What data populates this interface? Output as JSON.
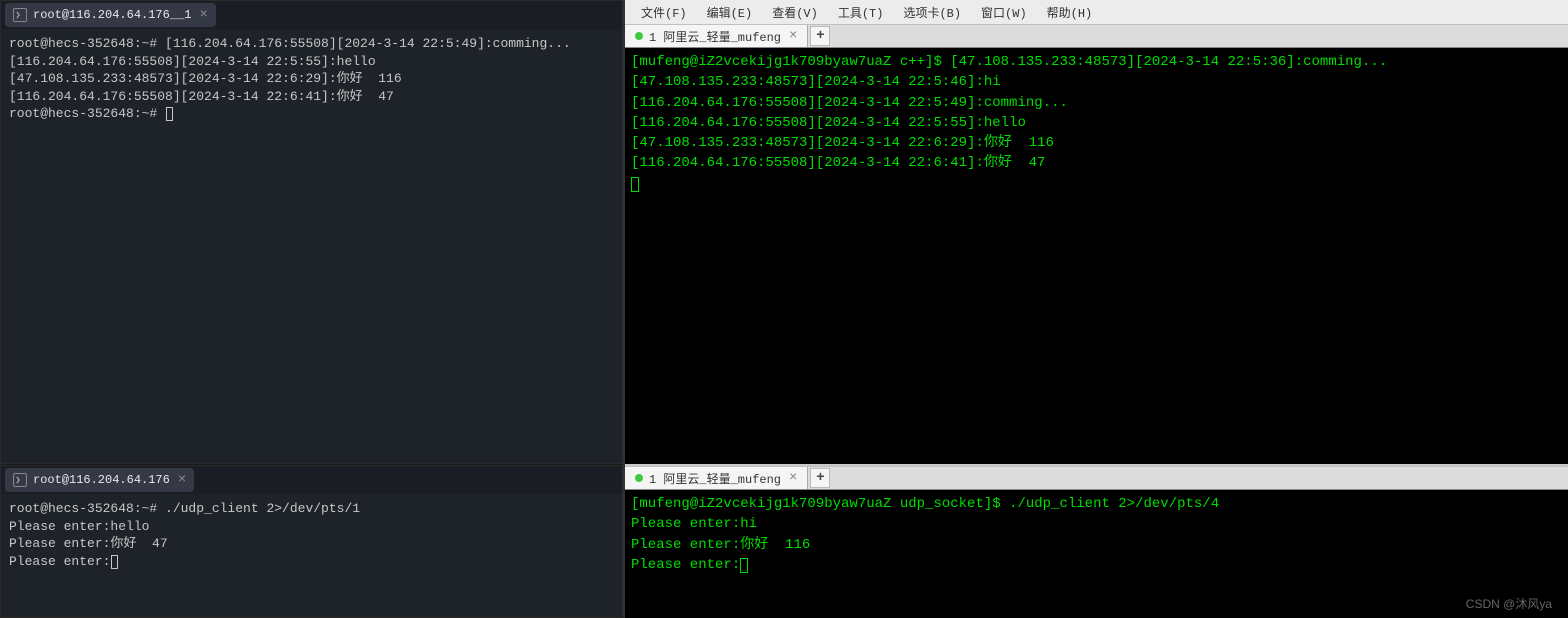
{
  "left_top": {
    "tab_title": "root@116.204.64.176__1",
    "lines": [
      "root@hecs-352648:~# [116.204.64.176:55508][2024-3-14 22:5:49]:comming...",
      "[116.204.64.176:55508][2024-3-14 22:5:55]:hello",
      "[47.108.135.233:48573][2024-3-14 22:6:29]:你好  116",
      "[116.204.64.176:55508][2024-3-14 22:6:41]:你好  47",
      "root@hecs-352648:~# "
    ]
  },
  "left_bottom": {
    "tab_title": "root@116.204.64.176",
    "lines": [
      "root@hecs-352648:~# ./udp_client 2>/dev/pts/1",
      "Please enter:hello",
      "Please enter:你好  47",
      "Please enter:"
    ]
  },
  "right_menu": [
    "文件(F)",
    "编辑(E)",
    "查看(V)",
    "工具(T)",
    "选项卡(B)",
    "窗口(W)",
    "帮助(H)"
  ],
  "right_top": {
    "tab_title": "1 阿里云_轻量_mufeng",
    "lines": [
      "[mufeng@iZ2vcekijg1k709byaw7uaZ c++]$ [47.108.135.233:48573][2024-3-14 22:5:36]:comming...",
      "[47.108.135.233:48573][2024-3-14 22:5:46]:hi",
      "[116.204.64.176:55508][2024-3-14 22:5:49]:comming...",
      "[116.204.64.176:55508][2024-3-14 22:5:55]:hello",
      "[47.108.135.233:48573][2024-3-14 22:6:29]:你好  116",
      "[116.204.64.176:55508][2024-3-14 22:6:41]:你好  47"
    ]
  },
  "right_bottom": {
    "tab_title": "1 阿里云_轻量_mufeng",
    "lines": [
      "[mufeng@iZ2vcekijg1k709byaw7uaZ udp_socket]$ ./udp_client 2>/dev/pts/4",
      "Please enter:hi",
      "Please enter:你好  116",
      "Please enter:"
    ]
  },
  "watermark": "CSDN @沐风ya",
  "add_tab": "+",
  "close_symbol": "×"
}
